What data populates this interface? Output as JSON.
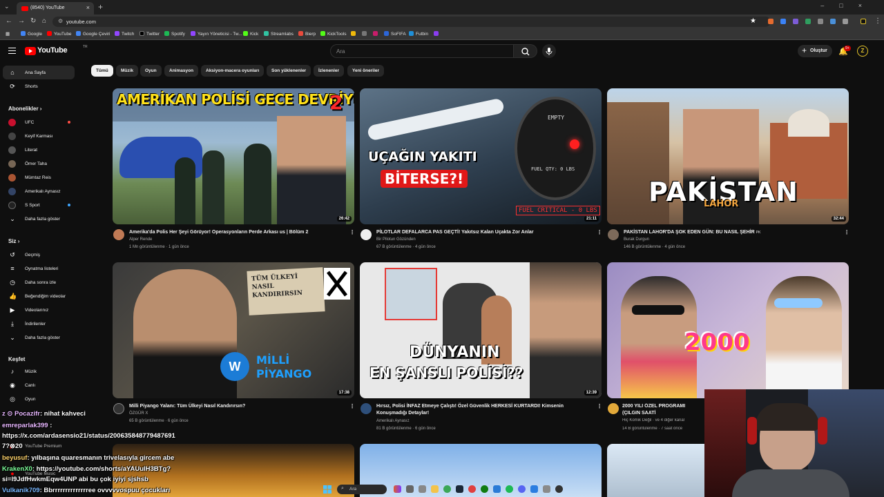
{
  "browser": {
    "tab_title": "(8540) YouTube",
    "url": "youtube.com",
    "bookmarks": [
      "Google",
      "YouTube",
      "Google Çeviri",
      "Twitch",
      "Twitter",
      "Spotify",
      "Yayın Yöneticisi - Tw...",
      "Kick",
      "Streamlabs",
      "Bierp",
      "KickTools",
      "SoFIFA",
      "Futbin"
    ]
  },
  "header": {
    "logo": "YouTube",
    "logo_region": "TR",
    "search_placeholder": "Ara",
    "create_label": "Oluştur",
    "notif_count": "9+",
    "avatar_letter": "Z"
  },
  "sidebar": {
    "main": [
      {
        "label": "Ana Sayfa",
        "icon": "home-icon"
      },
      {
        "label": "Shorts",
        "icon": "shorts-icon"
      }
    ],
    "subs_title": "Abonelikler",
    "subs": [
      {
        "label": "UFC",
        "color": "#c8102e"
      },
      {
        "label": "Keyif Karması",
        "color": "#444444"
      },
      {
        "label": "Literat",
        "color": "#555555"
      },
      {
        "label": "Ömer Taha",
        "color": "#776655"
      },
      {
        "label": "Mümtaz Reis",
        "color": "#aa5533"
      },
      {
        "label": "Amerikalı Aynasız",
        "color": "#334466"
      },
      {
        "label": "S Sport",
        "color": "#222222"
      },
      {
        "label": "Daha fazla göster",
        "color": ""
      }
    ],
    "you_title": "Siz",
    "you": [
      {
        "label": "Geçmiş",
        "icon": "history-icon"
      },
      {
        "label": "Oynatma listeleri",
        "icon": "playlists-icon"
      },
      {
        "label": "Daha sonra izle",
        "icon": "watch-later-icon"
      },
      {
        "label": "Beğendiğim videolar",
        "icon": "like-icon"
      },
      {
        "label": "Videolarınız",
        "icon": "your-videos-icon"
      },
      {
        "label": "İndirilenler",
        "icon": "download-icon"
      },
      {
        "label": "Daha fazla göster",
        "icon": "chevron-down-icon"
      }
    ],
    "explore_title": "Keşfet",
    "explore": [
      {
        "label": "Müzik",
        "icon": "music-icon"
      },
      {
        "label": "Canlı",
        "icon": "live-icon"
      },
      {
        "label": "Oyun",
        "icon": "gaming-icon"
      }
    ],
    "more": [
      "YouTube Premium",
      "YouTube Music"
    ]
  },
  "chips": [
    "Tümü",
    "Müzik",
    "Oyun",
    "Animasyon",
    "Aksiyon-macera oyunları",
    "Son yüklenenler",
    "İzlenenler",
    "Yeni öneriler"
  ],
  "videos": [
    {
      "title": "Amerika'da Polis Her Şeyi Görüyor! Operasyonların Perde Arkası us | Bölüm 2",
      "channel": "Alper Rende",
      "meta": "1 Mn görüntülenme · 1 gün önce",
      "duration": "26:42",
      "thumb_text": "AMERİKAN POLİSİ GECE DEVRİYESİ",
      "thumb_num": "2"
    },
    {
      "title": "PİLOTLAR DEFALARCA PAS GEÇTİ! Yakıtsız Kalan Uçakta Zor Anlar",
      "channel": "Bir Pilotun Gözünden",
      "meta": "67 B görüntülenme · 4 gün önce",
      "duration": "21:11",
      "thumb_text": "UÇAĞIN YAKITI",
      "thumb_text2": "BİTERSE?!",
      "thumb_text3": "FUEL CRITICAL - 0 LBS",
      "gauge_label": "FUEL QTY: 0 LBS",
      "gauge_empty": "EMPTY"
    },
    {
      "title": "PAKİSTAN LAHOR'DA ŞOK EDEN GÜN: BU NASIL ŞEHİR",
      "channel": "Burak Durgun",
      "meta": "146 B görüntülenme · 4 gün önce",
      "duration": "32:44",
      "thumb_text": "PAKİSTAN",
      "thumb_text2": "LAHOR",
      "flag": "PK"
    },
    {
      "title": "Milli Piyango Yalanı: Tüm Ülkeyi Nasıl Kandırırsın?",
      "channel": "ÖZGÜR X",
      "meta": "65 B görüntülenme · 6 gün önce",
      "duration": "17:38",
      "thumb_text": "MİLLİ PİYANGO",
      "thumb_text2": "TÜM ÜLKEYİ NASIL KANDIRIRSIN"
    },
    {
      "title": "Hırsız, Polisi İNFAZ Etmeye Çalıştı! Özel Güvenlik HERKESİ KURTARDI! Kimsenin Konuşmadığı Detaylar!",
      "channel": "Amerikalı Aynasız",
      "meta": "81 B görüntülenme · 6 gün önce",
      "duration": "12:39",
      "thumb_text": "DÜNYANIN",
      "thumb_text2": "EN ŞANSLI POLİSİ??"
    },
    {
      "title": "2000 YILI ÖZEL PROGRAMI (ÇILGIN SAATİ",
      "channel": "Hiç Komik Değil · ve 4 diğer kanal",
      "meta": "14 B görüntülenme · 7 saat önce",
      "duration": "",
      "thumb_text": "2000"
    }
  ],
  "chat": [
    {
      "user": "z ⊙ Pocazifr",
      "msg": ": nihat kahveci"
    },
    {
      "user": "emreparlak399",
      "msg": ":"
    },
    {
      "user": "",
      "msg": "https://x.com/ardasensio21/status/2006358487794876​91"
    },
    {
      "user": "",
      "msg": "7?⊗20"
    },
    {
      "user": "beyusuf",
      "msg": ": yılbaşına quaresmanın trivelasıyla gircem abe"
    },
    {
      "user": "KrakenX0",
      "msg": ": https://youtube.com/shorts/aYAUuIH3BTg?"
    },
    {
      "user": "",
      "msg": "si=l9JdfHwkmEqw4UNP abi bu çok iyiyi sjshsb"
    },
    {
      "user": "Vulkanik709",
      "msg": ": Bbrrrrrrrrrrrrrree ovvvvvospuu çocukları"
    }
  ],
  "taskbar": {
    "search": "Ara"
  }
}
